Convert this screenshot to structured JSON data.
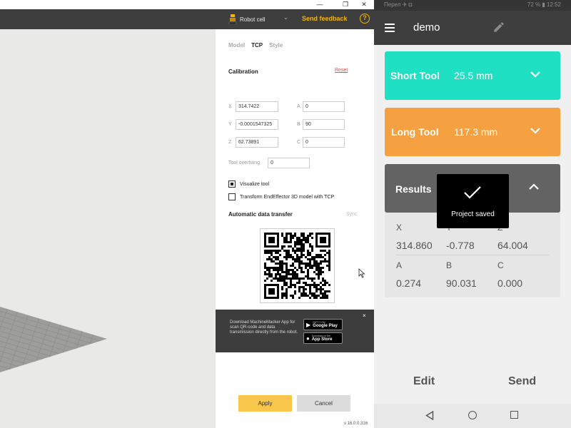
{
  "desktop": {
    "topbar": {
      "robot_name": "Robot cell",
      "feedback_label": "Send feedback",
      "help_label": "?"
    },
    "window_controls": [
      "—",
      "❐",
      "✕"
    ],
    "tabs": [
      {
        "label": "Model",
        "active": false
      },
      {
        "label": "TCP",
        "active": true
      },
      {
        "label": "Style",
        "active": false
      }
    ],
    "calibration": {
      "title": "Calibration",
      "reset_label": "Reset",
      "fields": {
        "x": {
          "label": "X",
          "value": "314.7422"
        },
        "y": {
          "label": "Y",
          "value": "-0.0001547325"
        },
        "z": {
          "label": "Z",
          "value": "62.73891"
        },
        "a": {
          "label": "A",
          "value": "0"
        },
        "b": {
          "label": "B",
          "value": "90"
        },
        "c": {
          "label": "C",
          "value": "0"
        },
        "overhang": {
          "label": "Tool overhang",
          "value": "0"
        }
      }
    },
    "checkboxes": {
      "visualize": {
        "label": "Visualize tool",
        "checked": true
      },
      "transform": {
        "label": "Transform EndEffector 3D model with TCP",
        "checked": false
      }
    },
    "auto_transfer": {
      "title": "Automatic data transfer",
      "sync_label": "Sync"
    },
    "banner": {
      "text": "Download MachineMacker App for scan QR-code and data transmission directly from the robot.",
      "google_small": "GET IT ON",
      "google_big": "Google Play",
      "apple_small": "Download on the",
      "apple_big": "App Store",
      "close": "×"
    },
    "buttons": {
      "apply": "Apply",
      "cancel": "Cancel"
    },
    "version": "v 16.0.0.316"
  },
  "phone": {
    "status": {
      "left": "Перел ✈ ◘",
      "right": "72 % ▮ 12:52"
    },
    "app_title": "demo",
    "short_tool": {
      "name": "Short Tool",
      "value": "25.5 mm"
    },
    "long_tool": {
      "name": "Long Tool",
      "value": "117.3 mm"
    },
    "results": {
      "title": "Results",
      "x": {
        "label": "X",
        "value": "314.860"
      },
      "y": {
        "label": "Y",
        "value": "-0.778"
      },
      "z": {
        "label": "Z",
        "value": "64.004"
      },
      "a": {
        "label": "A",
        "value": "0.274"
      },
      "b": {
        "label": "B",
        "value": "90.031"
      },
      "c": {
        "label": "C",
        "value": "0.000"
      }
    },
    "toast": "Project saved",
    "edit_label": "Edit",
    "send_label": "Send"
  },
  "colors": {
    "short_tool": "#20e0c4",
    "long_tool": "#f5a142",
    "results": "#636363",
    "accent": "#f4b400",
    "apply": "#f7c64a"
  }
}
